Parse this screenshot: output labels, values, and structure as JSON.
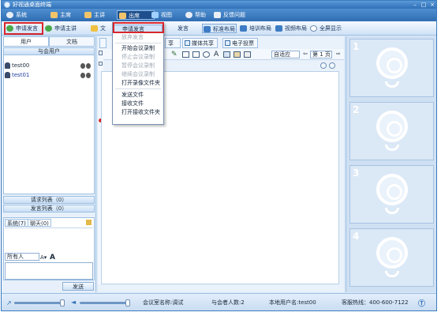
{
  "window": {
    "title": "好视通桌面终端"
  },
  "menu": {
    "items": [
      {
        "label": "系统",
        "color": "#e9eef5"
      },
      {
        "label": "主席",
        "color": "#f2c46a"
      },
      {
        "label": "主讲",
        "color": "#f2c46a"
      },
      {
        "label": "出席",
        "color": "#f2c46a"
      },
      {
        "label": "视图",
        "color": "#9fd0ff"
      },
      {
        "label": "帮助",
        "color": "#e9eef5"
      },
      {
        "label": "反馈问题",
        "color": "#e9eef5"
      }
    ],
    "active_index": 3
  },
  "toolbar": {
    "apply_speak": "申请发言",
    "apply_presenter": "申请主讲",
    "partial1": "文",
    "partial2": "发言",
    "standard_layout": "标准布局",
    "training_layout": "培训布局",
    "video_layout": "视频布局",
    "fullscreen": "全屏显示"
  },
  "left": {
    "tab_users": "用户",
    "tab_docs": "文档",
    "attendees_header": "与会用户",
    "users": [
      {
        "name": "test00",
        "color": "#1a2a3a"
      },
      {
        "name": "test01",
        "color": "#1f3fa0"
      }
    ],
    "request_list": "请求列表（0）",
    "speak_list": "发言列表（0）",
    "chat_tab_system": "系统(7)",
    "chat_tab_chat": "聊天(0)",
    "recipient": "所有人",
    "send_button": "发送"
  },
  "center": {
    "tabs": [
      "享",
      "媒体共享",
      "电子投票"
    ],
    "zoom": "自适应",
    "page": "第 1 页"
  },
  "dropdown": {
    "items": [
      {
        "label": "申请发言",
        "state": "highlight"
      },
      {
        "label": "放弃发言",
        "state": "dim"
      },
      {
        "label": "开始会议录制",
        "state": "normal"
      },
      {
        "label": "停止会议录制",
        "state": "dim"
      },
      {
        "label": "暂停会议录制",
        "state": "dim"
      },
      {
        "label": "继续会议录制",
        "state": "dim"
      },
      {
        "label": "打开录像文件夹",
        "state": "normal"
      },
      {
        "label": "发送文件",
        "state": "normal"
      },
      {
        "label": "接收文件",
        "state": "normal"
      },
      {
        "label": "打开接收文件夹",
        "state": "normal"
      }
    ]
  },
  "video": {
    "slots": [
      "1",
      "2",
      "3",
      "4"
    ]
  },
  "status": {
    "meeting_name": "会议室名称:调试",
    "attendee_count": "与会者人数:2",
    "local_user": "本地用户名:test00",
    "hotline": "客服热线：400-600-7122"
  },
  "colors": {
    "accent": "#2f6fb7",
    "highlight_box": "#d8262c"
  }
}
